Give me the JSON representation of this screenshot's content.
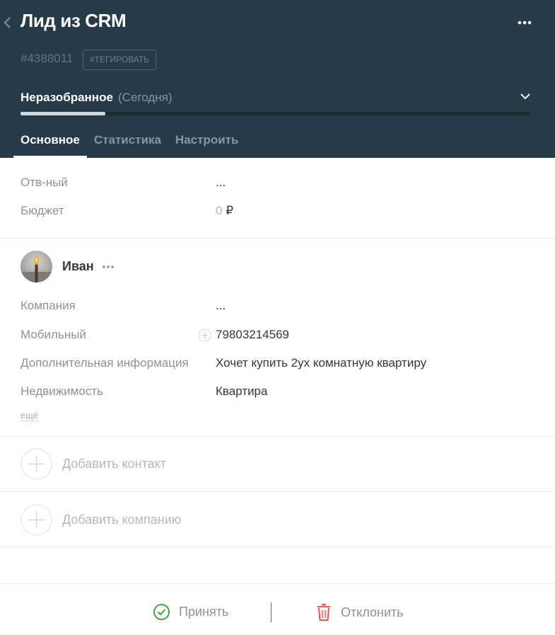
{
  "header": {
    "title": "Лид из CRM",
    "lead_id": "#4388011",
    "tag_button": "#ТЕГИРОВАТЬ",
    "stage": {
      "name": "Неразобранное",
      "date": "(Сегодня)",
      "progress": 0.166
    },
    "tabs": [
      {
        "label": "Основное",
        "active": true
      },
      {
        "label": "Статистика",
        "active": false
      },
      {
        "label": "Настроить",
        "active": false
      }
    ]
  },
  "lead_fields": [
    {
      "label": "Отв-ный",
      "value": "..."
    },
    {
      "label": "Бюджет",
      "value_amount": "0",
      "value_currency": "₽"
    }
  ],
  "contact": {
    "name": "Иван",
    "fields": [
      {
        "label": "Компания",
        "value": "..."
      },
      {
        "label": "Мобильный",
        "value": "79803214569"
      },
      {
        "label": "Дополнительная информация",
        "value": "Хочет купить 2ух комнатную квартиру"
      },
      {
        "label": "Недвижимость",
        "value": "Квартира"
      }
    ],
    "more_link": "ещё"
  },
  "actions": {
    "add_contact": "Добавить контакт",
    "add_company": "Добавить компанию"
  },
  "footer": {
    "accept": "Принять",
    "reject": "Отклонить"
  },
  "colors": {
    "header_bg": "#263b47",
    "accept": "#3aa83a",
    "reject": "#e05a5a"
  },
  "icons": [
    "back-icon",
    "more-icon",
    "chevron-down-icon",
    "plus-icon",
    "check-circle-icon",
    "trash-icon"
  ]
}
